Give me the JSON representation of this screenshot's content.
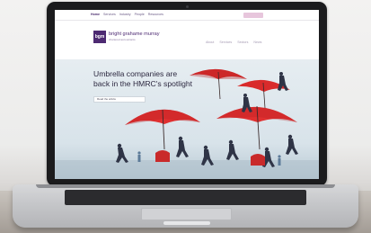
{
  "site": {
    "top_nav": [
      "Home",
      "Services",
      "Industry",
      "People",
      "Resources"
    ],
    "logo_mark": "bgm",
    "brand_name": "bright grahame murray",
    "brand_tagline": "chartered accountants",
    "main_nav": [
      "About",
      "Services",
      "Sectors",
      "News"
    ]
  },
  "hero": {
    "headline_line1": "Umbrella companies are",
    "headline_line2": "back in the HMRC's spotlight",
    "button_label": "Read the article"
  },
  "colors": {
    "brand_purple": "#4d2a72",
    "umbrella_red": "#d92b2b",
    "laptop_bezel": "#1b1b1d"
  }
}
